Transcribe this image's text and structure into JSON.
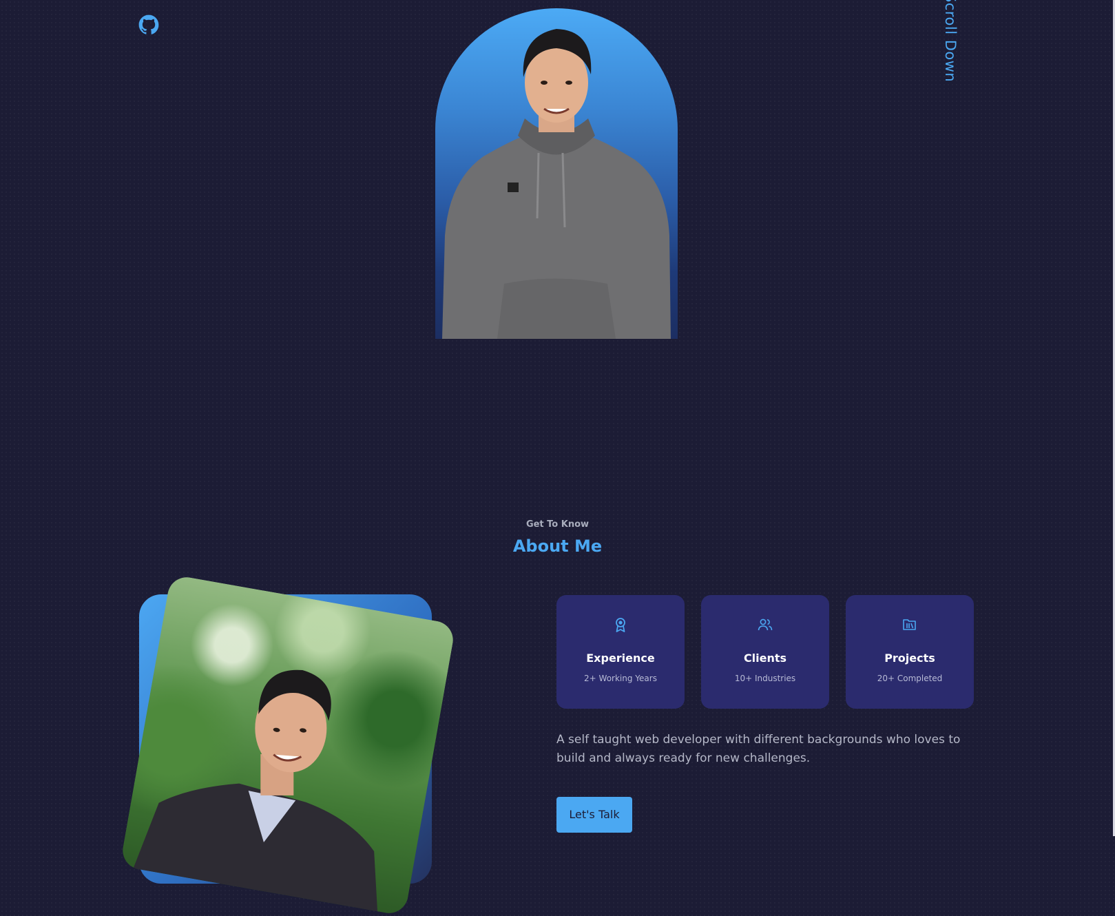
{
  "hero": {
    "github_icon": "github-icon",
    "scroll_label": "Scroll Down",
    "accent": "#4ba8f2"
  },
  "about": {
    "kicker": "Get To Know",
    "title": "About Me",
    "cards": [
      {
        "icon": "award-icon",
        "title": "Experience",
        "subtitle": "2+ Working Years"
      },
      {
        "icon": "users-icon",
        "title": "Clients",
        "subtitle": "10+ Industries"
      },
      {
        "icon": "folder-icon",
        "title": "Projects",
        "subtitle": "20+ Completed"
      }
    ],
    "description": "A self taught web developer with different backgrounds who loves to build and always ready for new challenges.",
    "cta_label": "Let's Talk"
  },
  "colors": {
    "background": "#1c1c35",
    "card": "#2b2b6e",
    "accent": "#4ba8f2"
  }
}
